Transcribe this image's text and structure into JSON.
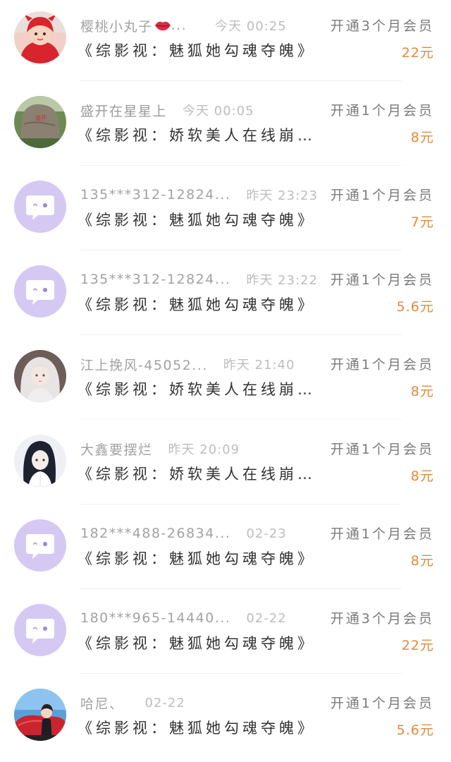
{
  "orders": [
    {
      "name": "樱桃小丸子",
      "name_emoji": "lips-icon",
      "name_suffix": " ...",
      "time": "今天 00:25",
      "product": "《综影视：魅狐她勾魂夺魄》",
      "plan": "开通3个月会员",
      "price": "22元",
      "avatar": "photo-baby-red-costume"
    },
    {
      "name": "盛开在星星上",
      "time": "今天 00:05",
      "product": "《综影视：娇软美人在线崩...",
      "plan": "开通1个月会员",
      "price": "8元",
      "avatar": "photo-engraved-rock"
    },
    {
      "name": "135***312-12824...",
      "time": "昨天 23:23",
      "product": "《综影视：魅狐她勾魂夺魄》",
      "plan": "开通1个月会员",
      "price": "7元",
      "avatar": "default-chat-bubble-icon"
    },
    {
      "name": "135***312-12824...",
      "time": "昨天 23:22",
      "product": "《综影视：魅狐她勾魂夺魄》",
      "plan": "开通1个月会员",
      "price": "5.6元",
      "avatar": "default-chat-bubble-icon"
    },
    {
      "name": "江上挽风-45052...",
      "time": "昨天 21:40",
      "product": "《综影视：娇软美人在线崩...",
      "plan": "开通1个月会员",
      "price": "8元",
      "avatar": "anime-white-hair-girl"
    },
    {
      "name": "大鑫要摆烂",
      "time": "昨天 20:09",
      "product": "《综影视：娇软美人在线崩...",
      "plan": "开通1个月会员",
      "price": "8元",
      "avatar": "anime-dark-hair-boy"
    },
    {
      "name": "182***488-26834...",
      "time": "02-23",
      "product": "《综影视：魅狐她勾魂夺魄》",
      "plan": "开通1个月会员",
      "price": "8元",
      "avatar": "default-chat-bubble-icon"
    },
    {
      "name": "180***965-14440...",
      "time": "02-22",
      "product": "《综影视：魅狐她勾魂夺魄》",
      "plan": "开通3个月会员",
      "price": "22元",
      "avatar": "default-chat-bubble-icon"
    },
    {
      "name": "哈尼、",
      "time": "02-22",
      "product": "《综影视：魅狐她勾魂夺魄》",
      "plan": "开通1个月会员",
      "price": "5.6元",
      "avatar": "photo-girl-red-car"
    }
  ],
  "colors": {
    "price": "#e08a3c",
    "name": "#a2a2a2",
    "time": "#bdbdbd",
    "product": "#333333",
    "plan": "#7a7a7a",
    "default_avatar": "#d5c8f3"
  }
}
